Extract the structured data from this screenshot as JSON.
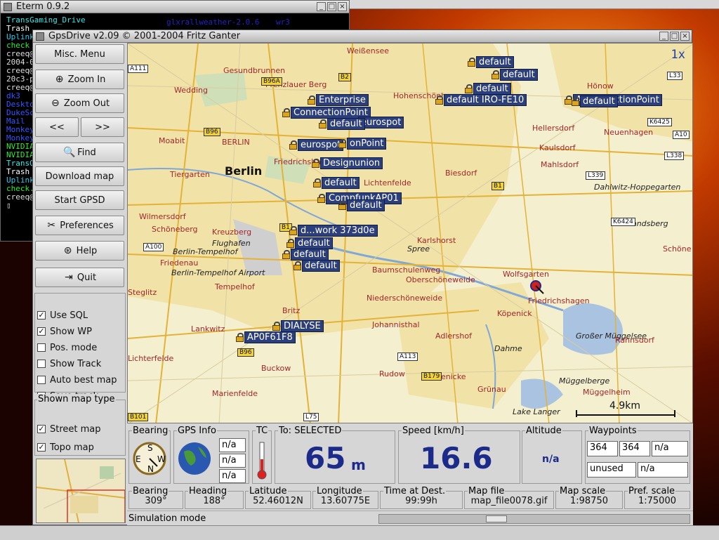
{
  "eterm": {
    "title": "Eterm 0.9.2",
    "lines": [
      {
        "text": "TransGaming_Drive",
        "color": "#2ee8e8"
      },
      {
        "text": "Trash",
        "color": "#ffffff"
      },
      {
        "text": "Uplink",
        "color": "#2ec8e8"
      },
      {
        "text": "check",
        "color": "#2ee82e"
      },
      {
        "text": "creeq@",
        "color": "#dddddd"
      },
      {
        "text": "2004-0",
        "color": "#dddddd"
      },
      {
        "text": "creeq@",
        "color": "#dddddd"
      },
      {
        "text": "20c3-p",
        "color": "#dddddd"
      },
      {
        "text": "creeq@",
        "color": "#dddddd"
      },
      {
        "text": "dk3",
        "color": "#3355ff"
      },
      {
        "text": "Deskto",
        "color": "#3355ff"
      },
      {
        "text": "DukeSc",
        "color": "#3355ff"
      },
      {
        "text": "Mail",
        "color": "#3355ff"
      },
      {
        "text": "Monkey",
        "color": "#3355ff"
      },
      {
        "text": "Monkey",
        "color": "#3355ff"
      },
      {
        "text": "NVIDIA",
        "color": "#2ee82e"
      },
      {
        "text": "NVIDIA",
        "color": "#2ee82e"
      },
      {
        "text": "TransG",
        "color": "#2ee8e8"
      },
      {
        "text": "Trash",
        "color": "#ffffff"
      },
      {
        "text": "Uplink",
        "color": "#2ec8e8"
      },
      {
        "text": "check.",
        "color": "#2ee82e"
      },
      {
        "text": "creeq@",
        "color": "#dddddd"
      },
      {
        "text": "▯",
        "color": "#dddddd"
      }
    ],
    "extra1": "glxrallweather-2.0.6",
    "extra2": "wr3"
  },
  "window": {
    "title": "GpsDrive v2.09  © 2001-2004 Fritz Ganter"
  },
  "buttons": {
    "misc_menu": "Misc. Menu",
    "zoom_in": "Zoom In",
    "zoom_out": "Zoom Out",
    "prev": "<<",
    "next": ">>",
    "find": "Find",
    "download_map": "Download map",
    "start_gpsd": "Start GPSD",
    "preferences": "Preferences",
    "help": "Help",
    "quit": "Quit"
  },
  "options": [
    {
      "label": "Use SQL",
      "checked": true
    },
    {
      "label": "Show WP",
      "checked": true
    },
    {
      "label": "Pos. mode",
      "checked": false
    },
    {
      "label": "Show Track",
      "checked": false
    },
    {
      "label": "Auto best map",
      "checked": false
    },
    {
      "label": "Save track",
      "checked": false
    }
  ],
  "map_type": {
    "title": "Shown map type",
    "items": [
      {
        "label": "Street map",
        "checked": true
      },
      {
        "label": "Topo map",
        "checked": true
      }
    ]
  },
  "map": {
    "zoom": "1x",
    "scale_label": "4.9km",
    "labels": [
      {
        "text": "Weißensee",
        "type": "red"
      },
      {
        "text": "Gesundbrunnen",
        "type": "red"
      },
      {
        "text": "Wedding",
        "type": "red"
      },
      {
        "text": "Prenzlauer Berg",
        "type": "red"
      },
      {
        "text": "Hohenschönhausen",
        "type": "red"
      },
      {
        "text": "Hönow",
        "type": "red"
      },
      {
        "text": "Hellersdorf",
        "type": "red"
      },
      {
        "text": "Neuenhagen",
        "type": "red"
      },
      {
        "text": "Moabit",
        "type": "red"
      },
      {
        "text": "BERLIN",
        "type": "red"
      },
      {
        "text": "Berlin",
        "type": "big"
      },
      {
        "text": "Friedrichshain",
        "type": "red"
      },
      {
        "text": "Kaulsdorf",
        "type": "red"
      },
      {
        "text": "Mahlsdorf",
        "type": "red"
      },
      {
        "text": "Tiergarten",
        "type": "red"
      },
      {
        "text": "Biesdorf",
        "type": "red"
      },
      {
        "text": "Dahlwitz-Hoppegarten",
        "type": "blk"
      },
      {
        "text": "Lichtenfelde",
        "type": "red"
      },
      {
        "text": "Wilmersdorf",
        "type": "red"
      },
      {
        "text": "Kreuzberg",
        "type": "red"
      },
      {
        "text": "Schöneberg",
        "type": "red"
      },
      {
        "text": "Flughafen",
        "type": "blk"
      },
      {
        "text": "Berlin-Tempelhof",
        "type": "blk"
      },
      {
        "text": "Karlshorst",
        "type": "red"
      },
      {
        "text": "Spree",
        "type": "blk"
      },
      {
        "text": "Friedenau",
        "type": "red"
      },
      {
        "text": "Berlin-Tempelhof Airport",
        "type": "blk"
      },
      {
        "text": "Baumschulenweg",
        "type": "red"
      },
      {
        "text": "Oberschöneweide",
        "type": "red"
      },
      {
        "text": "Tempelhof",
        "type": "red"
      },
      {
        "text": "Wolfsgarten",
        "type": "red"
      },
      {
        "text": "Friedrichshagen",
        "type": "red"
      },
      {
        "text": "Steglitz",
        "type": "red"
      },
      {
        "text": "Niederschöneweide",
        "type": "red"
      },
      {
        "text": "Köpenick",
        "type": "red"
      },
      {
        "text": "Britz",
        "type": "red"
      },
      {
        "text": "Lankwitz",
        "type": "red"
      },
      {
        "text": "Johannisthal",
        "type": "red"
      },
      {
        "text": "Großer Müggelsee",
        "type": "blk"
      },
      {
        "text": "Adlershof",
        "type": "red"
      },
      {
        "text": "Rahnsdorf",
        "type": "red"
      },
      {
        "text": "Dahme",
        "type": "blk"
      },
      {
        "text": "Lichterfelde",
        "type": "red"
      },
      {
        "text": "Buckow",
        "type": "red"
      },
      {
        "text": "Rudow",
        "type": "red"
      },
      {
        "text": "Altglienicke",
        "type": "red"
      },
      {
        "text": "Müggelberge",
        "type": "blk"
      },
      {
        "text": "Grünau",
        "type": "red"
      },
      {
        "text": "Müggelheim",
        "type": "red"
      },
      {
        "text": "Marienfelde",
        "type": "red"
      },
      {
        "text": "Lake Langer",
        "type": "blk"
      },
      {
        "text": "Schöne",
        "type": "red"
      },
      {
        "text": "Altlandsberg",
        "type": "blk"
      }
    ],
    "shields": [
      {
        "text": "A111",
        "y": false
      },
      {
        "text": "B2",
        "y": true
      },
      {
        "text": "B96A",
        "y": true
      },
      {
        "text": "B96",
        "y": true
      },
      {
        "text": "B1",
        "y": true
      },
      {
        "text": "A100",
        "y": false
      },
      {
        "text": "B96",
        "y": true
      },
      {
        "text": "A113",
        "y": false
      },
      {
        "text": "B179",
        "y": true
      },
      {
        "text": "B101",
        "y": true
      },
      {
        "text": "L75",
        "y": false
      },
      {
        "text": "L33",
        "y": false
      },
      {
        "text": "K6425",
        "y": false
      },
      {
        "text": "A10",
        "y": false
      },
      {
        "text": "L338",
        "y": false
      },
      {
        "text": "L339",
        "y": false
      },
      {
        "text": "K6424",
        "y": false
      },
      {
        "text": "B1",
        "y": true
      }
    ],
    "waypoints": [
      "default",
      "default",
      "default",
      "default IRO-FE10",
      "A ConnectionPoint",
      "default",
      "Enterprise",
      "ConnectionPoint",
      "eurospot",
      "default",
      "eurospot",
      "onPoint",
      "Designunion",
      "default",
      "CompfunkAP01",
      "default",
      "d...work 373d0e",
      "default",
      "default",
      "default",
      "DIALYSE",
      "AP0F61F8"
    ]
  },
  "info": {
    "bearing_title": "Bearing",
    "compass_letters": [
      "S",
      "W",
      "E",
      "N"
    ],
    "gps_title": "GPS Info",
    "gps_values": [
      "n/a",
      "n/a",
      "n/a"
    ],
    "tc_title": "TC",
    "to_title": "To: SELECTED",
    "distance": "65",
    "distance_unit": "m",
    "speed_title": "Speed [km/h]",
    "speed": "16.6",
    "altitude_title": "Altitude",
    "altitude": "n/a",
    "waypoints_title": "Waypoints",
    "wp_values": [
      "364",
      "364",
      "n/a"
    ],
    "wp_unused": "unused",
    "wp_na": "n/a",
    "row2": [
      {
        "title": "Bearing",
        "value": "309°"
      },
      {
        "title": "Heading",
        "value": "188°"
      },
      {
        "title": "Latitude",
        "value": "52.46012N"
      },
      {
        "title": "Longitude",
        "value": "13.60775E"
      },
      {
        "title": "Time at Dest.",
        "value": "99:99h"
      },
      {
        "title": "Map file",
        "value": "map_file0078.gif"
      },
      {
        "title": "Map scale",
        "value": "1:98750"
      },
      {
        "title": "Pref. scale",
        "value": "1:75000"
      }
    ],
    "status": "Simulation mode"
  },
  "colors": {
    "accent": "#1c2a8a",
    "waypoint": "#2c3f7a"
  }
}
